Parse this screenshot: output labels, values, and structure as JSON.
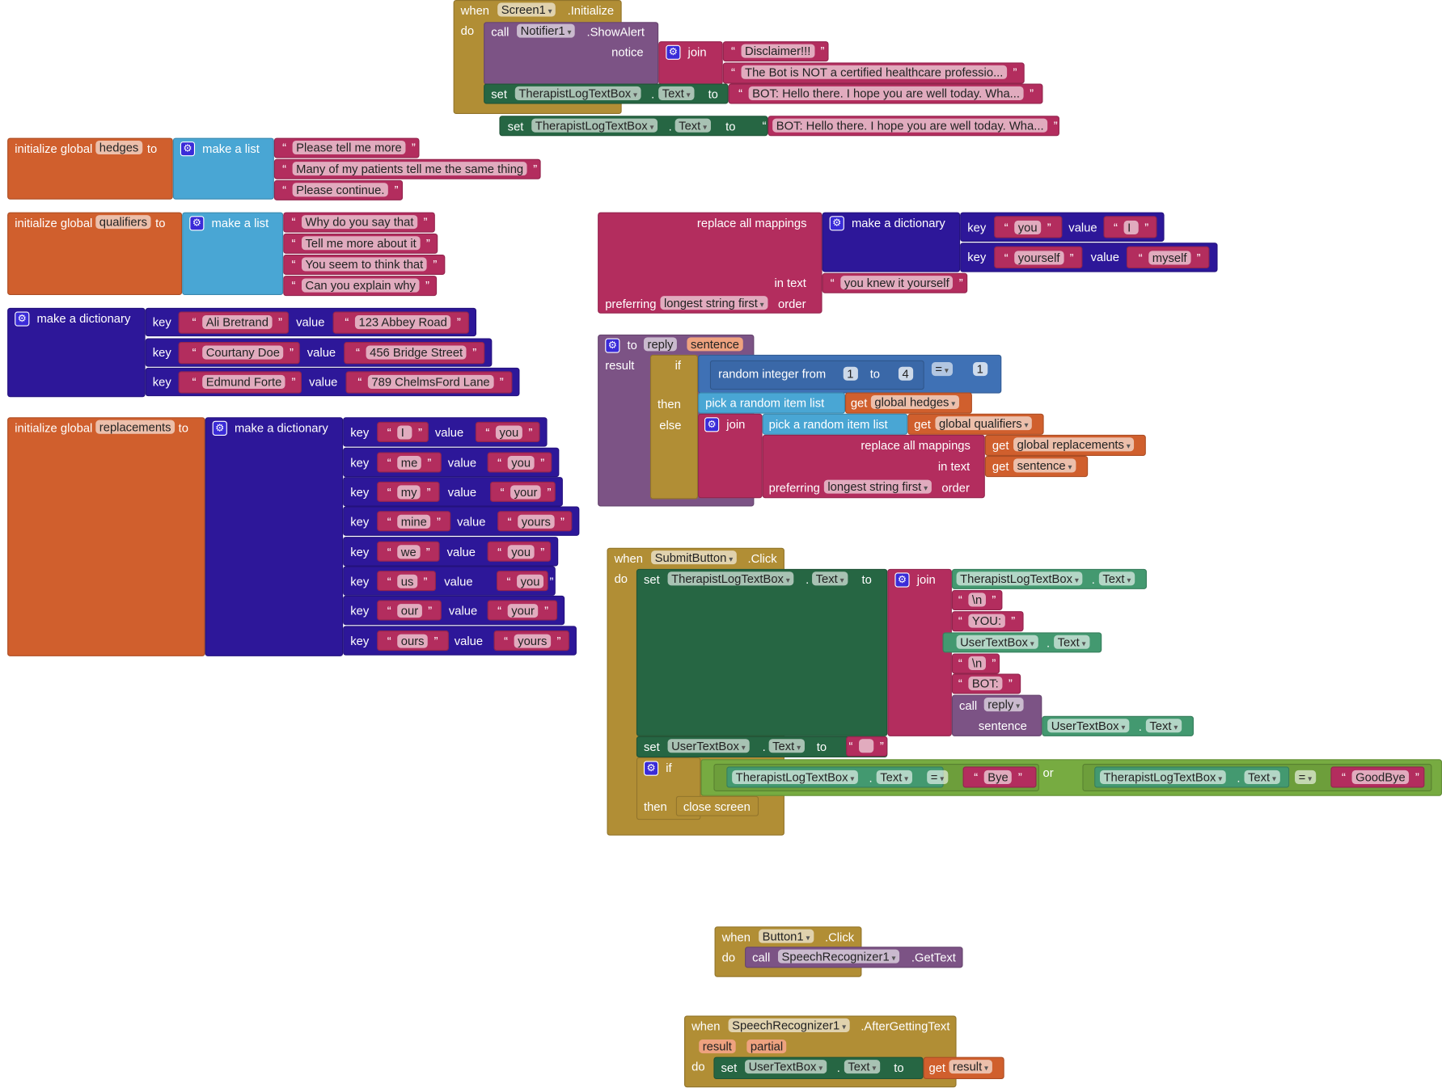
{
  "colors": {
    "event": "#b18e35",
    "proc": "#7c5385",
    "text": "#b32d5e",
    "setter": "#266643",
    "getter": "#439970",
    "var": "#d05f2d",
    "list": "#49a6d4",
    "dict": "#2d1799",
    "math": "#3f71b5",
    "logic": "#77ab41",
    "param": "#eea27f",
    "mathinner": "#3a68a8",
    "logicinner": "#6d9e3b"
  },
  "icons": {
    "mutator": "gear-icon",
    "dropdown": "chevron-down-icon"
  },
  "si": {
    "when": "when",
    "comp": "Screen1",
    "event": ".Initialize",
    "do": "do",
    "call": "call",
    "notifier": "Notifier1",
    "method": ".ShowAlert",
    "notice": "notice",
    "join": "join",
    "s1": "Disclaimer!!!",
    "s2": "The Bot is NOT a certified healthcare professio...",
    "set": "set",
    "target": "TherapistLogTextBox",
    "dot": ".",
    "prop": "Text",
    "to": "to",
    "s3": "BOT: Hello there. I hope you are well today. Wha..."
  },
  "ls": {
    "set": "set",
    "target": "TherapistLogTextBox",
    "dot": ".",
    "prop": "Text",
    "to": "to",
    "value": "BOT: Hello there. I hope you are well today. Wha..."
  },
  "hedges": {
    "init": "initialize global",
    "name": "hedges",
    "to": "to",
    "make": "make a list",
    "items": [
      "Please tell me more",
      "Many of my patients tell me the same thing",
      "Please continue."
    ]
  },
  "q": {
    "init": "initialize global",
    "name": "qualifiers",
    "to": "to",
    "make": "make a list",
    "items": [
      "Why do you say that",
      "Tell me more about it",
      "You seem to think that",
      "Can you explain why"
    ]
  },
  "d1": {
    "make": "make a dictionary",
    "key": "key",
    "value": "value",
    "rows": [
      {
        "k": "Ali Bretrand",
        "v": "123 Abbey Road"
      },
      {
        "k": "Courtany Doe",
        "v": "456 Bridge Street"
      },
      {
        "k": "Edmund Forte",
        "v": "789 ChelmsFord Lane"
      }
    ]
  },
  "rep": {
    "init": "initialize global",
    "name": "replacements",
    "to": "to",
    "make": "make a dictionary",
    "key": "key",
    "value": "value",
    "rows": [
      {
        "k": "I",
        "v": "you"
      },
      {
        "k": "me",
        "v": "you"
      },
      {
        "k": "my",
        "v": "your"
      },
      {
        "k": "mine",
        "v": "yours"
      },
      {
        "k": "we",
        "v": "you"
      },
      {
        "k": "us",
        "v": "you"
      },
      {
        "k": "our",
        "v": "your"
      },
      {
        "k": "ours",
        "v": "yours"
      }
    ]
  },
  "ra": {
    "replace": "replace all mappings",
    "intext": "in text",
    "pref": "preferring",
    "mode": "longest string first",
    "order": "order",
    "make": "make a dictionary",
    "key": "key",
    "value": "value",
    "k1": "you",
    "v1": "I",
    "k2": "yourself",
    "v2": "myself",
    "text": "you knew it yourself"
  },
  "rp": {
    "to": "to",
    "name": "reply",
    "param": "sentence",
    "result": "result",
    "if": "if",
    "then": "then",
    "else": "else",
    "rand": "random integer from",
    "from": "1",
    "to2": "to",
    "upper": "4",
    "eq": "=",
    "cmp": "1",
    "pick": "pick a random item  list",
    "get": "get",
    "hedges": "global hedges",
    "join": "join",
    "qual": "global qualifiers",
    "replace": "replace all mappings",
    "intext": "in text",
    "pref": "preferring",
    "mode": "longest string first",
    "order": "order",
    "reps": "global replacements",
    "sentence": "sentence"
  },
  "sb": {
    "when": "when",
    "comp": "SubmitButton",
    "event": ".Click",
    "do": "do",
    "set": "set",
    "target": "TherapistLogTextBox",
    "dot": ".",
    "prop": "Text",
    "to": "to",
    "join": "join",
    "g1": "TherapistLogTextBox",
    "nl": "\\n",
    "you": "YOU:",
    "utb": "UserTextBox",
    "bot": "BOT:",
    "call": "call",
    "reply": "reply",
    "sentence": "sentence",
    "empty": "",
    "if": "if",
    "then": "then",
    "eq": "=",
    "bye": "Bye",
    "or": "or",
    "goodbye": "GoodBye",
    "close": "close screen"
  },
  "b1": {
    "when": "when",
    "comp": "Button1",
    "event": ".Click",
    "do": "do",
    "call": "call",
    "comp2": "SpeechRecognizer1",
    "method": ".GetText"
  },
  "sr": {
    "when": "when",
    "comp": "SpeechRecognizer1",
    "event": ".AfterGettingText",
    "p1": "result",
    "p2": "partial",
    "do": "do",
    "set": "set",
    "utb": "UserTextBox",
    "dot": ".",
    "prop": "Text",
    "to": "to",
    "get": "get",
    "result": "result"
  }
}
